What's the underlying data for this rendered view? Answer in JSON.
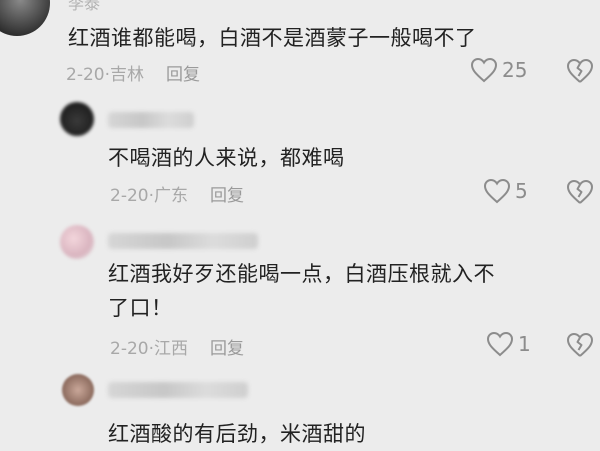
{
  "comments": [
    {
      "text": "红酒谁都能喝，白酒不是酒蒙子一般喝不了",
      "date": "2-20",
      "location": "吉林",
      "reply_label": "回复",
      "likes": "25",
      "author": "李泰"
    },
    {
      "text": "不喝酒的人来说，都难喝",
      "date": "2-20",
      "location": "广东",
      "reply_label": "回复",
      "likes": "5"
    },
    {
      "text_line1": "红酒我好歹还能喝一点，白酒压根就入不",
      "text_line2": "了口！",
      "date": "2-20",
      "location": "江西",
      "reply_label": "回复",
      "likes": "1"
    },
    {
      "text": "红酒酸的有后劲，米酒甜的"
    }
  ],
  "icons": {
    "like": "heart-outline-icon",
    "dislike": "broken-heart-icon"
  }
}
